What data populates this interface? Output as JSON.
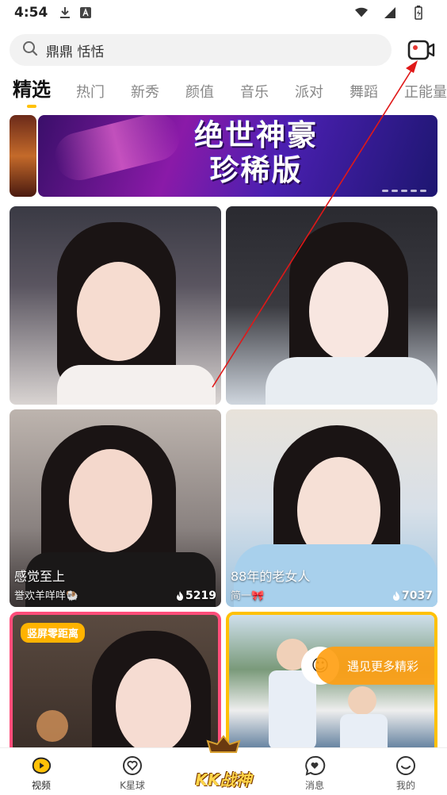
{
  "status_bar": {
    "time": "4:54"
  },
  "search": {
    "placeholder": "鼎鼎 恬恬"
  },
  "tabs": [
    {
      "label": "精选",
      "active": true
    },
    {
      "label": "热门"
    },
    {
      "label": "新秀"
    },
    {
      "label": "颜值"
    },
    {
      "label": "音乐"
    },
    {
      "label": "派对"
    },
    {
      "label": "舞蹈"
    },
    {
      "label": "正能量"
    }
  ],
  "banner": {
    "title_line1": "绝世神豪",
    "title_line2": "珍稀版"
  },
  "cards": [
    {
      "caption": "",
      "sub": "",
      "heat": ""
    },
    {
      "caption": "",
      "sub": "",
      "heat": ""
    },
    {
      "caption": "感觉至上",
      "sub": "誉欢羊咩咩🐏",
      "heat": "5219"
    },
    {
      "caption": "88年的老女人",
      "sub": "简一🎀",
      "heat": "7037"
    },
    {
      "tag": "竖屏零距离"
    },
    {
      "promo": "遇见更多精彩"
    }
  ],
  "bottom_nav": [
    {
      "label": "视频",
      "icon": "video-tab-icon"
    },
    {
      "label": "K星球",
      "icon": "planet-heart-icon"
    },
    {
      "label": "KK战神",
      "icon": "center-logo"
    },
    {
      "label": "消息",
      "icon": "message-icon"
    },
    {
      "label": "我的",
      "icon": "profile-icon"
    }
  ],
  "colors": {
    "accent": "#ffc107",
    "live_red": "#e53935"
  }
}
